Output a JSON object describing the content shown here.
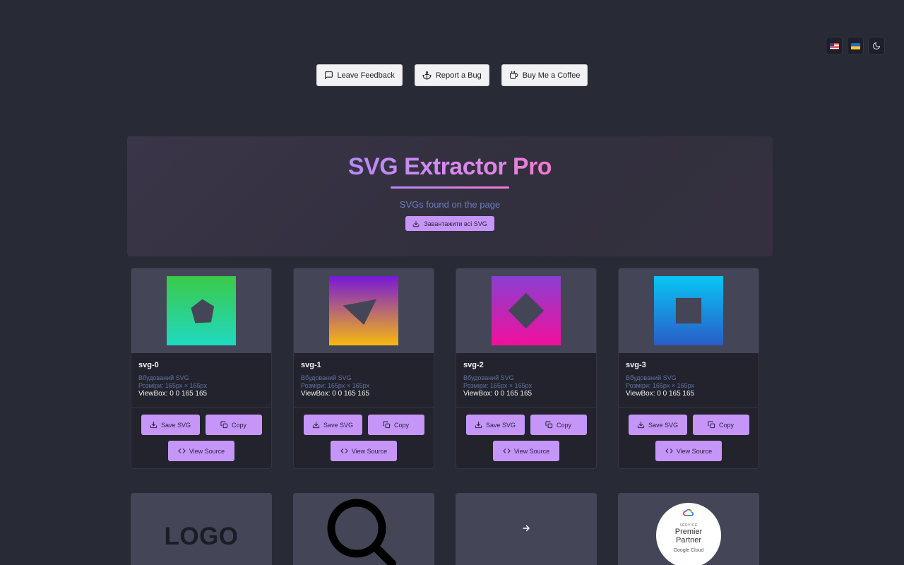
{
  "top_controls": {
    "english": "flag-us",
    "ukrainian": "flag-ua",
    "theme": "moon-icon"
  },
  "actions": {
    "feedback": "Leave Feedback",
    "bug": "Report a Bug",
    "coffee": "Buy Me a Coffee"
  },
  "hero": {
    "title": "SVG Extractor Pro",
    "subtitle": "SVGs found on the page",
    "download_all": "Завантажити всі SVG"
  },
  "cards": [
    {
      "name": "svg-0",
      "type": "Вбудований SVG",
      "size": "Розміри: 165px × 165px",
      "viewbox": "ViewBox: 0 0 165 165",
      "save": "Save SVG",
      "copy": "Copy",
      "source": "View Source"
    },
    {
      "name": "svg-1",
      "type": "Вбудований SVG",
      "size": "Розміри: 165px × 165px",
      "viewbox": "ViewBox: 0 0 165 165",
      "save": "Save SVG",
      "copy": "Copy",
      "source": "View Source"
    },
    {
      "name": "svg-2",
      "type": "Вбудований SVG",
      "size": "Розміри: 165px × 165px",
      "viewbox": "ViewBox: 0 0 165 165",
      "save": "Save SVG",
      "copy": "Copy",
      "source": "View Source"
    },
    {
      "name": "svg-3",
      "type": "Вбудований SVG",
      "size": "Розміри: 165px × 165px",
      "viewbox": "ViewBox: 0 0 165 165",
      "save": "Save SVG",
      "copy": "Copy",
      "source": "View Source"
    }
  ],
  "bottom_previews": {
    "logo_text": "LOGO",
    "badge_service": "SERVICE",
    "badge_premier": "Premier",
    "badge_partner": "Partner",
    "badge_gc": "Google Cloud"
  },
  "colors": {
    "accent": "#c596f7",
    "background": "#282a36"
  }
}
